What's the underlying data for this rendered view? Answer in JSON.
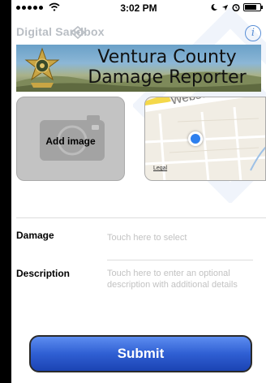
{
  "status_bar": {
    "time": "3:02 PM",
    "icons": [
      "signal-dots-icon",
      "wifi-icon",
      "moon-icon",
      "location-arrow-icon",
      "alarm-icon",
      "battery-icon"
    ]
  },
  "header": {
    "brand": "Digital Sandbox",
    "brand_icon": "sandbox-logo-icon",
    "info_icon": "info-icon"
  },
  "banner": {
    "title_line1": "Ventura County",
    "title_line2": "Damage Reporter",
    "badge_icon": "sheriff-star-badge-icon"
  },
  "tiles": {
    "add_image_label": "Add image",
    "map_street_label": "Webster St",
    "map_legal_label": "Legal"
  },
  "form": {
    "damage_label": "Damage",
    "damage_placeholder": "Touch here to select",
    "description_label": "Description",
    "description_placeholder": "Touch here to enter an optional description with additional details"
  },
  "submit_label": "Submit",
  "colors": {
    "accent_blue": "#2f5fd3",
    "placeholder_gray": "#c2c2c2",
    "location_dot": "#2d7fee"
  }
}
